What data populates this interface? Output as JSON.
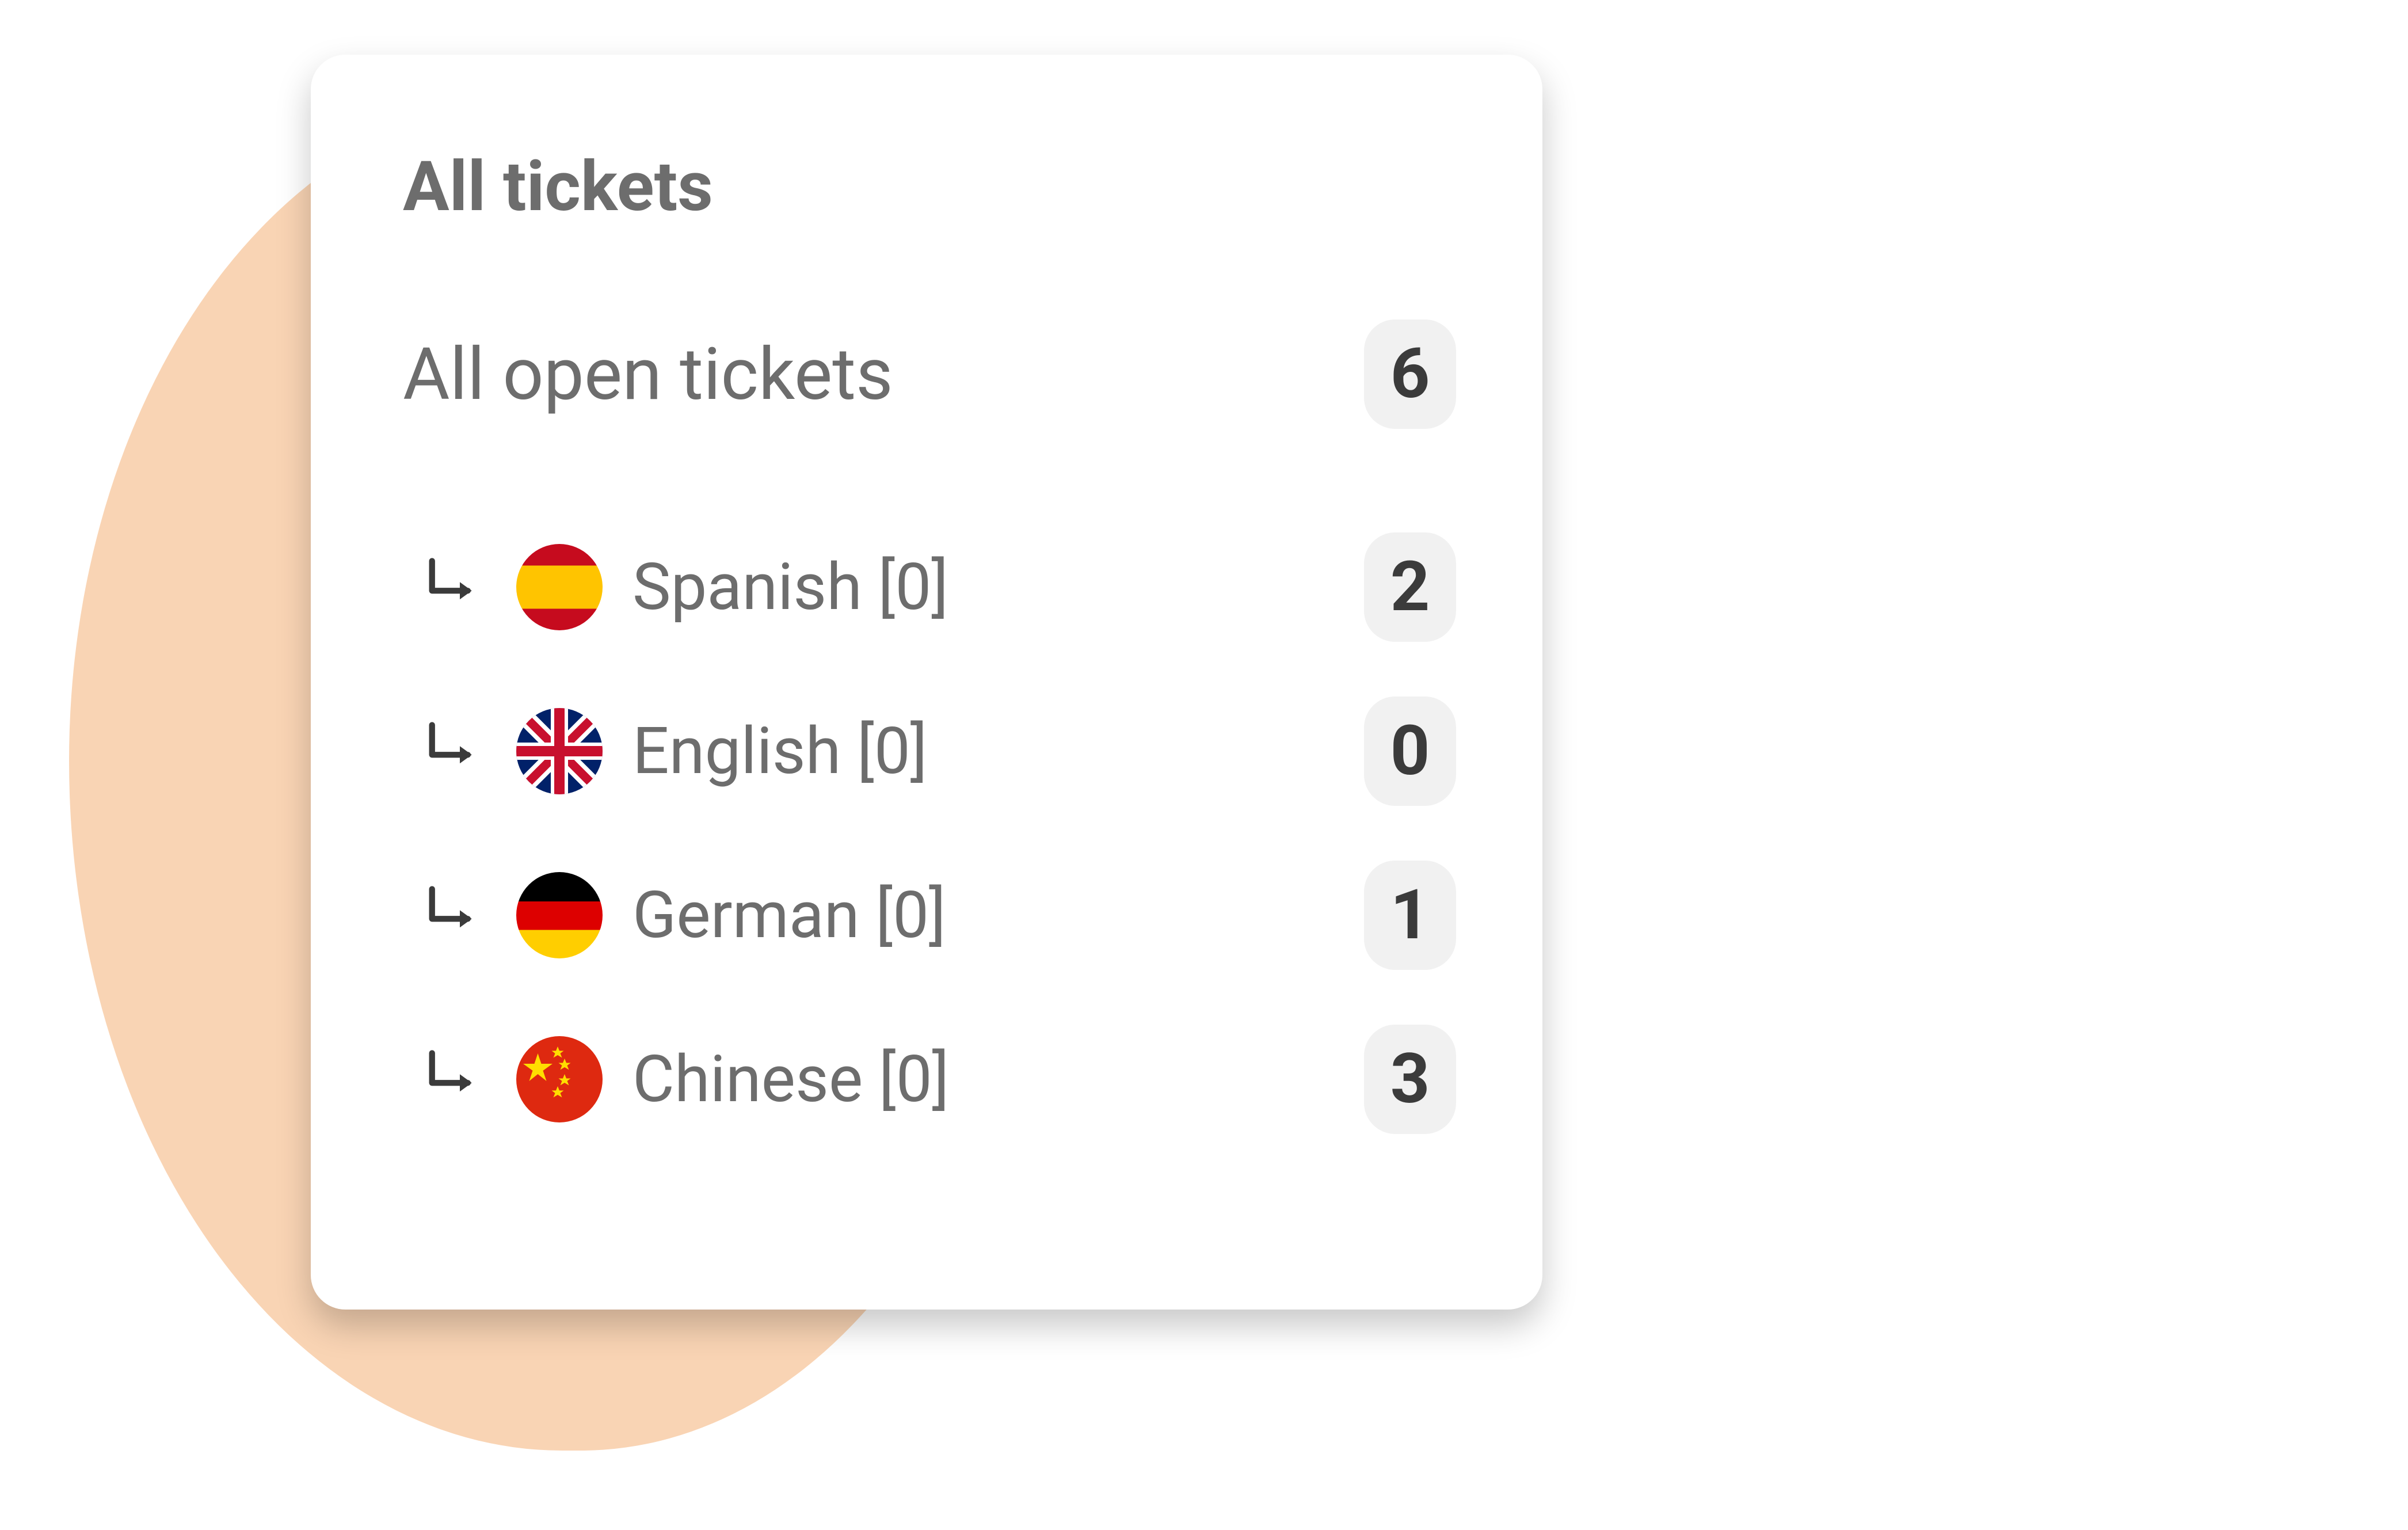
{
  "card": {
    "title": "All tickets",
    "summary": {
      "label": "All open tickets",
      "count": "6"
    },
    "languages": [
      {
        "key": "spanish",
        "label": "Spanish [0]",
        "count": "2",
        "flag": "es"
      },
      {
        "key": "english",
        "label": "English  [0]",
        "count": "0",
        "flag": "uk"
      },
      {
        "key": "german",
        "label": "German [0]",
        "count": "1",
        "flag": "de"
      },
      {
        "key": "chinese",
        "label": "Chinese [0]",
        "count": "3",
        "flag": "cn"
      }
    ]
  },
  "colors": {
    "peach_blob": "#f9d4b4",
    "text_medium": "#6d6d6d",
    "text_dark": "#3b3b3b",
    "badge_bg": "#f1f1f1"
  }
}
